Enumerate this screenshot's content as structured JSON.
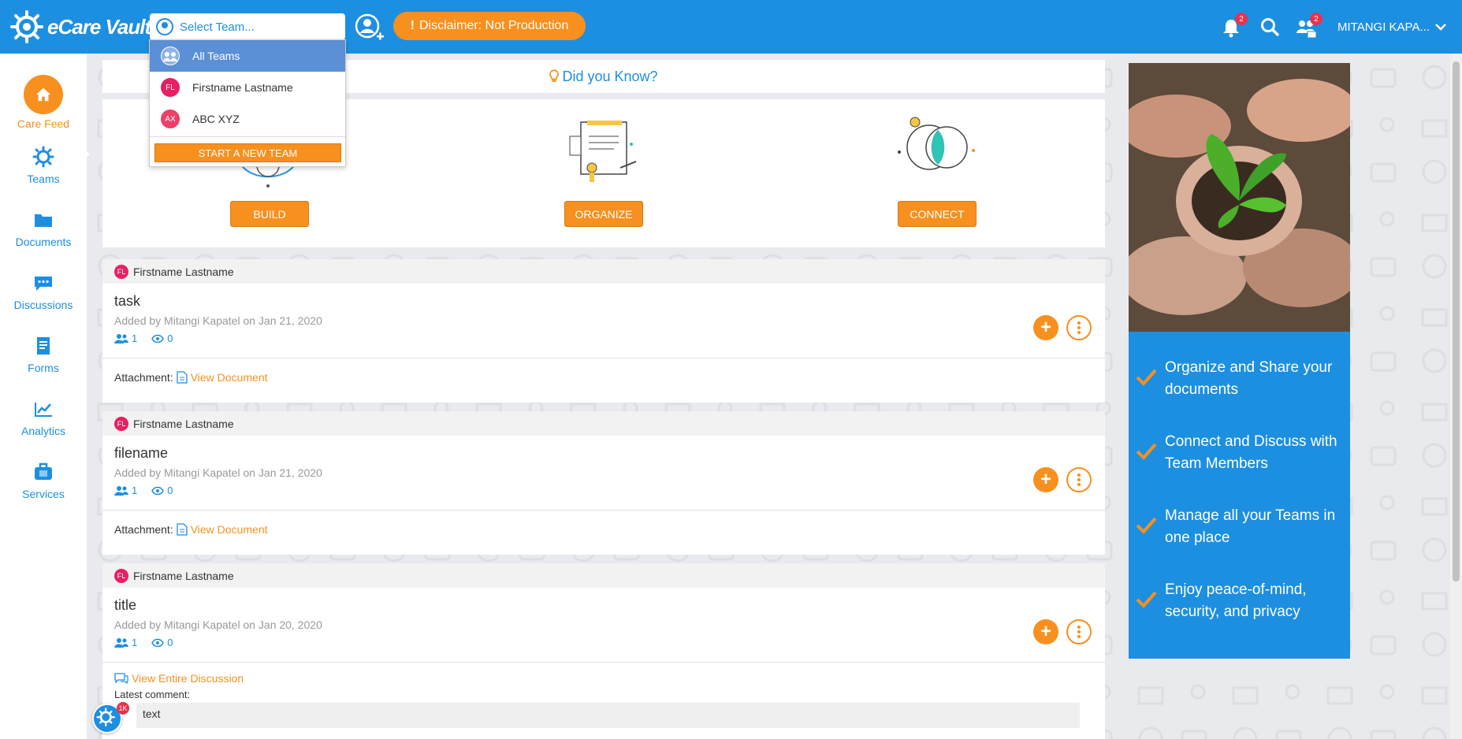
{
  "app": {
    "name": "eCare Vault"
  },
  "header": {
    "team_select_placeholder": "Select Team...",
    "disclaimer": "Disclaimer: Not Production",
    "notifications_count": "2",
    "team_requests_count": "2",
    "user_name": "MITANGI KAPA..."
  },
  "team_dropdown": {
    "items": [
      {
        "label": "All Teams",
        "avatar": "",
        "selected": true
      },
      {
        "label": "Firstname Lastname",
        "avatar": "FL"
      },
      {
        "label": "ABC XYZ",
        "avatar": "AX"
      }
    ],
    "new_team_label": "START A NEW TEAM"
  },
  "sidebar": {
    "items": [
      {
        "label": "Care Feed",
        "icon": "home-icon",
        "active": true
      },
      {
        "label": "Teams",
        "icon": "teams-icon"
      },
      {
        "label": "Documents",
        "icon": "folder-icon"
      },
      {
        "label": "Discussions",
        "icon": "chat-icon"
      },
      {
        "label": "Forms",
        "icon": "form-icon"
      },
      {
        "label": "Analytics",
        "icon": "chart-icon"
      },
      {
        "label": "Services",
        "icon": "briefcase-icon"
      }
    ]
  },
  "did_you_know": "Did you Know?",
  "feature_buttons": {
    "build": "BUILD",
    "organize": "ORGANIZE",
    "connect": "CONNECT"
  },
  "posts": [
    {
      "author_initials": "FL",
      "author": "Firstname Lastname",
      "title": "task",
      "meta": "Added by Mitangi Kapatel on Jan 21, 2020",
      "members": "1",
      "views": "0",
      "attachment_label": "Attachment:",
      "attachment_link": "View Document"
    },
    {
      "author_initials": "FL",
      "author": "Firstname Lastname",
      "title": "filename",
      "meta": "Added by Mitangi Kapatel on Jan 21, 2020",
      "members": "1",
      "views": "0",
      "attachment_label": "Attachment:",
      "attachment_link": "View Document"
    },
    {
      "author_initials": "FL",
      "author": "Firstname Lastname",
      "title": "title",
      "meta": "Added by Mitangi Kapatel on Jan 20, 2020",
      "members": "1",
      "views": "0",
      "discussion_link": "View Entire Discussion",
      "latest_comment_label": "Latest comment:",
      "latest_comment": "text"
    }
  ],
  "right_panel": {
    "items": [
      "Organize and Share your documents",
      "Connect and Discuss with Team Members",
      "Manage all your Teams in one place",
      "Enjoy peace-of-mind, security, and privacy"
    ]
  },
  "chat_badge": "1K",
  "colors": {
    "primary": "#1d8fe1",
    "accent": "#f7901e",
    "avatar": "#e91e63"
  }
}
